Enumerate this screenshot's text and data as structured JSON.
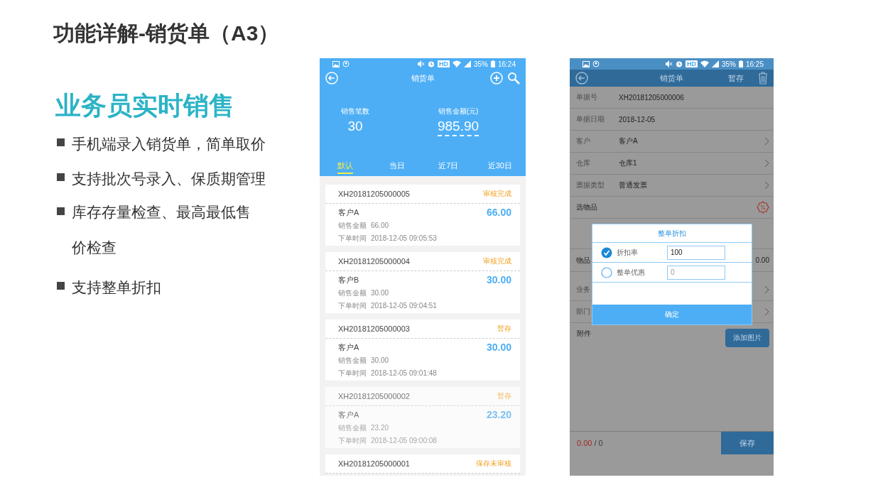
{
  "slide": {
    "title": "功能详解-销货单（A3）",
    "heading": "业务员实时销售",
    "bullets": [
      "手机端录入销货单，简单取价",
      "支持批次号录入、保质期管理",
      "库存存量检查、最高最低售价检查",
      "支持整单折扣"
    ]
  },
  "list_screen": {
    "status_bar": {
      "hd": "HD",
      "battery": "35%",
      "time": "16:24"
    },
    "title": "销货单",
    "summary": [
      {
        "kind": "count",
        "label": "销售笔数",
        "value": "30"
      },
      {
        "kind": "amount",
        "label": "销售金额(元)",
        "value": "985.90"
      }
    ],
    "tabs": [
      {
        "label": "默认",
        "selected": true
      },
      {
        "label": "当日",
        "selected": false
      },
      {
        "label": "近7日",
        "selected": false
      },
      {
        "label": "近30日",
        "selected": false
      }
    ],
    "orders": [
      {
        "number": "XH20181205000005",
        "status": "审核完成",
        "customer": "客户A",
        "amount": "66.00",
        "amount_label": "销售金额",
        "amount_value": "66.00",
        "time_label": "下单时间",
        "time": "2018-12-05 09:05:53",
        "faded": false
      },
      {
        "number": "XH20181205000004",
        "status": "审核完成",
        "customer": "客户B",
        "amount": "30.00",
        "amount_label": "销售金额",
        "amount_value": "30.00",
        "time_label": "下单时间",
        "time": "2018-12-05 09:04:51",
        "faded": false
      },
      {
        "number": "XH20181205000003",
        "status": "暂存",
        "customer": "客户A",
        "amount": "30.00",
        "amount_label": "销售金额",
        "amount_value": "30.00",
        "time_label": "下单时间",
        "time": "2018-12-05 09:01:48",
        "faded": false
      },
      {
        "number": "XH20181205000002",
        "status": "暂存",
        "customer": "客户A",
        "amount": "23.20",
        "amount_label": "销售金额",
        "amount_value": "23.20",
        "time_label": "下单时间",
        "time": "2018-12-05 09:00:08",
        "faded": true
      },
      {
        "number": "XH20181205000001",
        "status": "保存未审核",
        "faded": false
      }
    ]
  },
  "form_screen": {
    "status_bar": {
      "hd": "HD",
      "battery": "35%",
      "time": "16:25"
    },
    "title": "销货单",
    "draft_button": "暂存",
    "rows": [
      {
        "kind": "plain",
        "label": "单据号",
        "value": "XH20181205000006"
      },
      {
        "kind": "plain",
        "label": "单据日期",
        "value": "2018-12-05"
      },
      {
        "kind": "link",
        "label": "客户",
        "value": "客户A"
      },
      {
        "kind": "link",
        "label": "仓库",
        "value": "仓库1"
      },
      {
        "kind": "link",
        "label": "票据类型",
        "value": "普通发票"
      },
      {
        "kind": "tool",
        "label": "选物品"
      },
      {
        "kind": "total",
        "label": "物品",
        "value": "0.00"
      },
      {
        "kind": "link",
        "label": "业务"
      },
      {
        "kind": "link",
        "label": "部门"
      }
    ],
    "attachment": {
      "label": "附件",
      "button": "添加图片"
    },
    "footer": {
      "amount": "0.00",
      "count": "/ 0",
      "save_button": "保存"
    },
    "dialog": {
      "title": "整单折扣",
      "options": [
        {
          "label": "折扣率",
          "value": "100",
          "selected": true
        },
        {
          "label": "整单优惠",
          "value": "0",
          "selected": false
        }
      ],
      "confirm": "确定"
    }
  }
}
